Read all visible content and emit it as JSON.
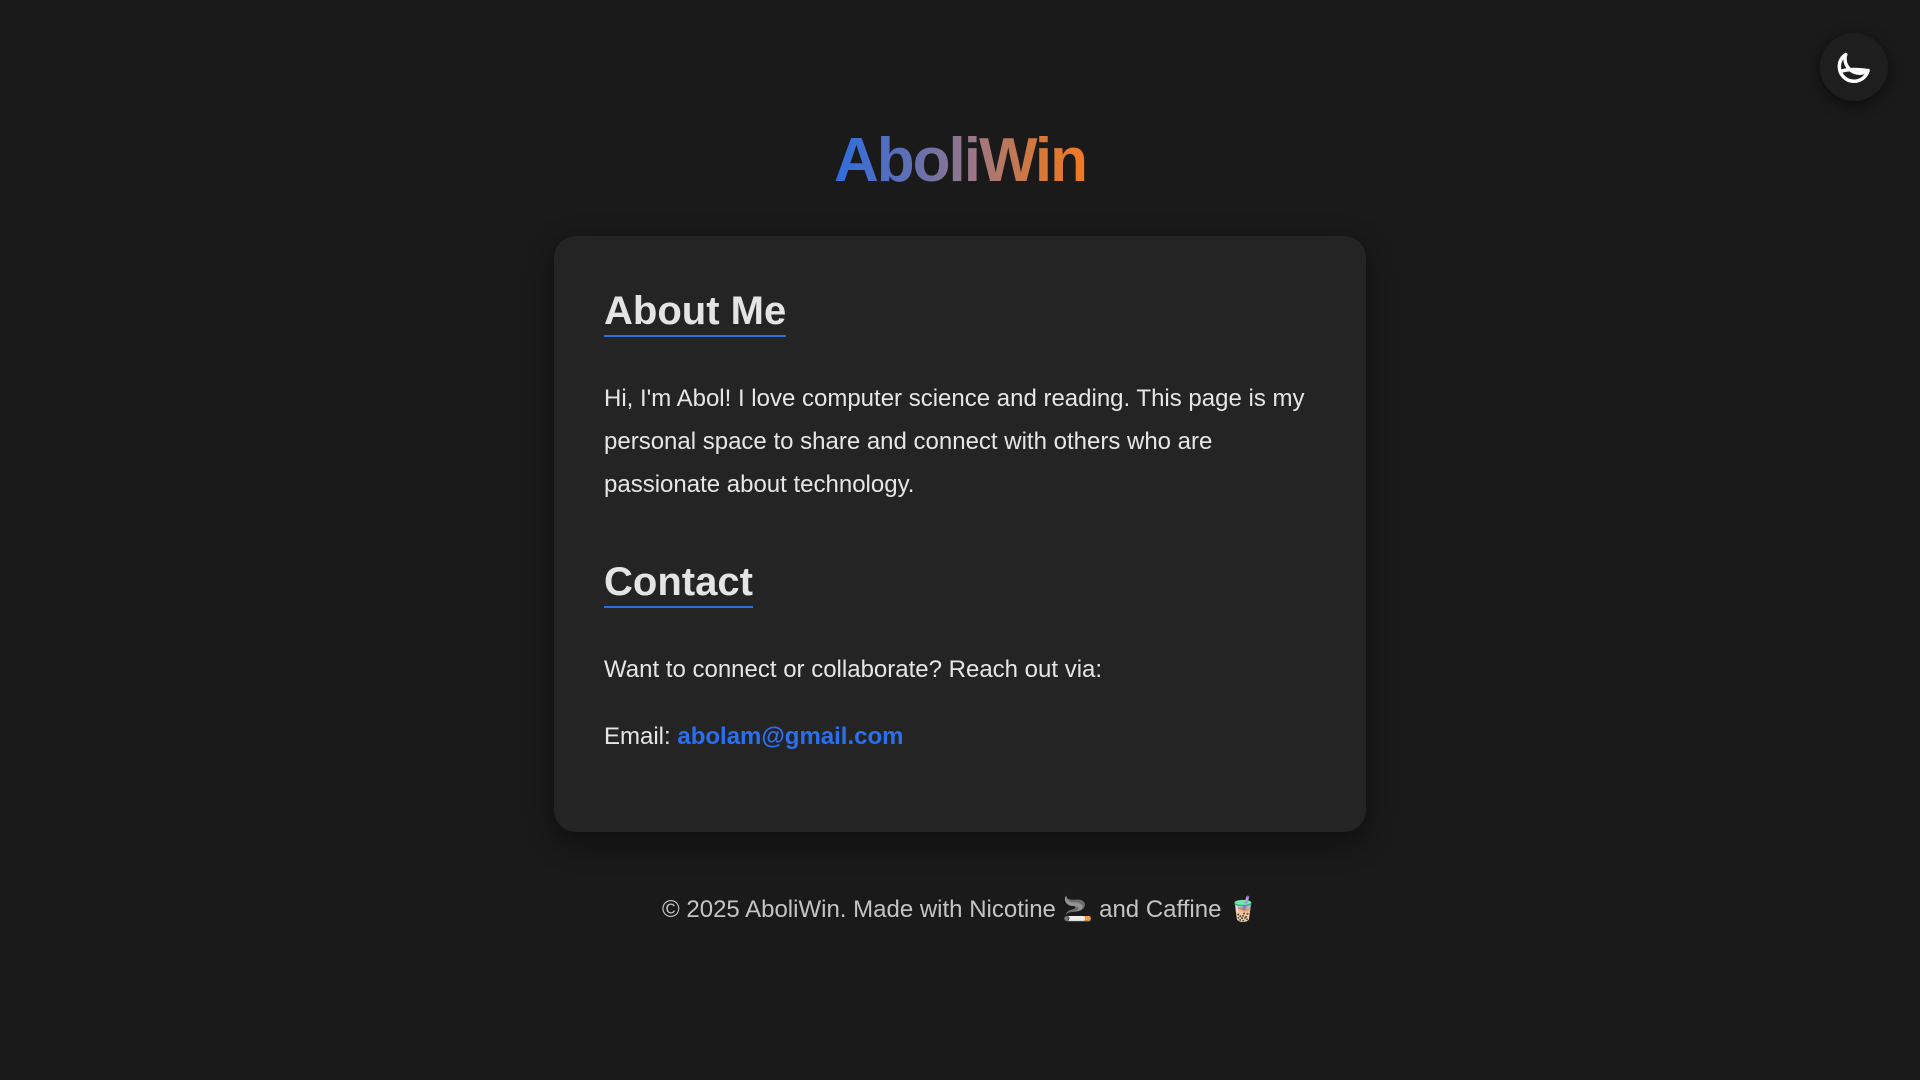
{
  "theme_toggle": {
    "icon": "moon-icon"
  },
  "header": {
    "title": "AboliWin",
    "gradient_colors": [
      "#2f6de0",
      "#f07a22"
    ]
  },
  "about": {
    "heading": "About Me",
    "text": "Hi, I'm Abol! I love computer science and reading. This page is my personal space to share and connect with others who are passionate about technology."
  },
  "contact": {
    "heading": "Contact",
    "intro": "Want to connect or collaborate? Reach out via:",
    "email_label": "Email:",
    "email": "abolam@gmail.com"
  },
  "footer": {
    "text": "© 2025 AboliWin. Made with Nicotine 🚬 and Caffine 🧋"
  },
  "colors": {
    "background": "#1a1a1a",
    "card": "#242424",
    "accent": "#2a6ff0"
  }
}
